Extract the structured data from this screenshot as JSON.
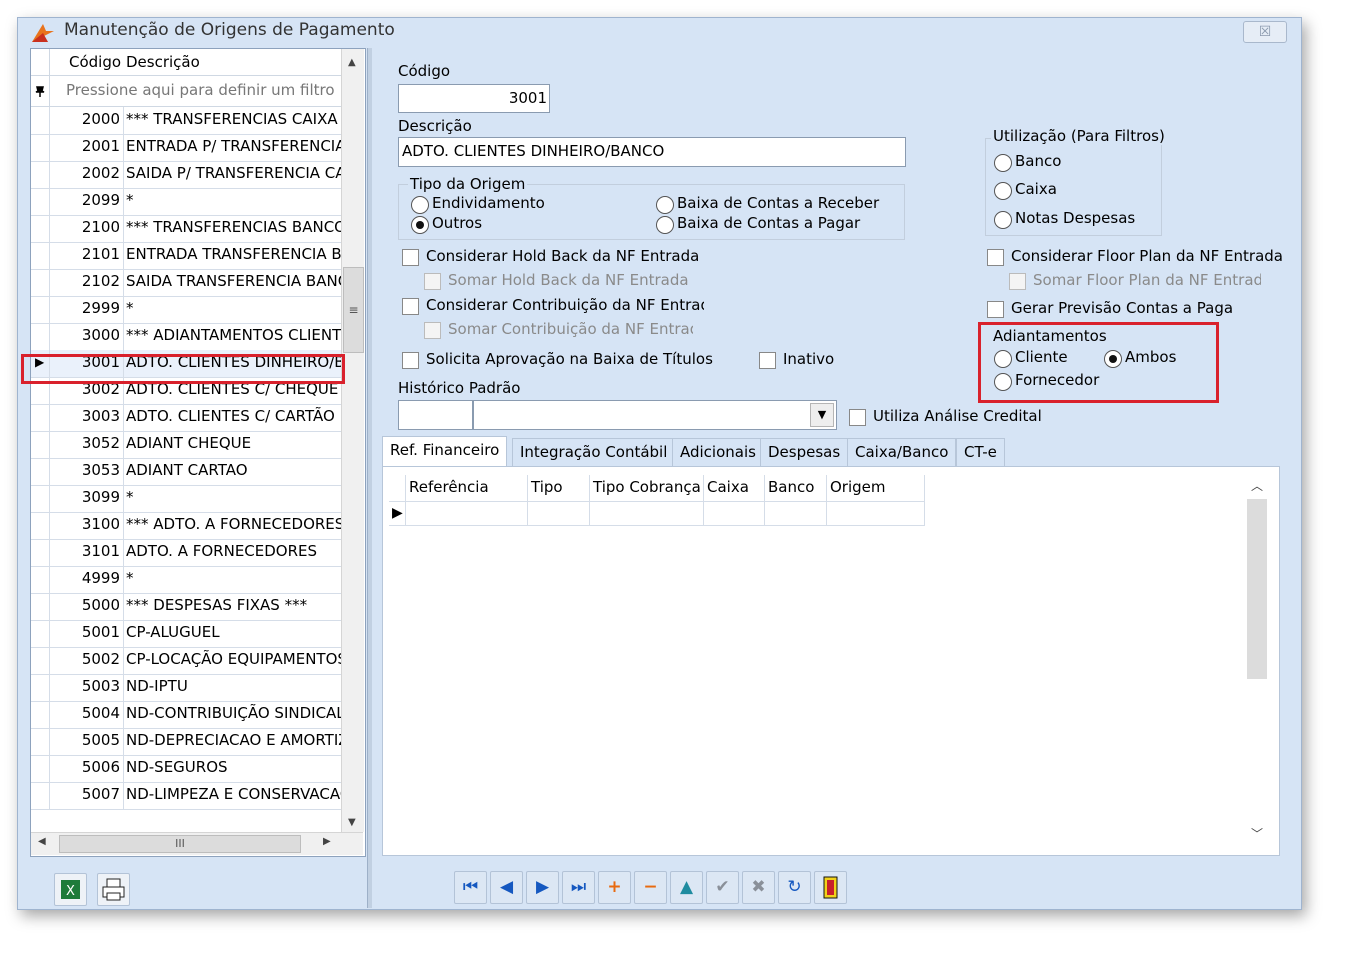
{
  "window": {
    "title": "Manutenção de Origens de Pagamento",
    "close_symbol": "☒"
  },
  "grid": {
    "headers": {
      "code": "Código",
      "desc": "Descrição"
    },
    "filter_placeholder": "Pressione aqui para definir um filtro",
    "rows": [
      {
        "code": "2000",
        "desc": "*** TRANSFERENCIAS CAIXA"
      },
      {
        "code": "2001",
        "desc": "ENTRADA P/ TRANSFERENCIA"
      },
      {
        "code": "2002",
        "desc": "SAIDA P/ TRANSFERENCIA CA"
      },
      {
        "code": "2099",
        "desc": "*"
      },
      {
        "code": "2100",
        "desc": "*** TRANSFERENCIAS BANCO"
      },
      {
        "code": "2101",
        "desc": "ENTRADA TRANSFERENCIA BA"
      },
      {
        "code": "2102",
        "desc": "SAIDA TRANSFERENCIA BANCO"
      },
      {
        "code": "2999",
        "desc": "*"
      },
      {
        "code": "3000",
        "desc": "*** ADIANTAMENTOS CLIENTES"
      },
      {
        "code": "3001",
        "desc": "ADTO. CLIENTES DINHEIRO/B"
      },
      {
        "code": "3002",
        "desc": "ADTO. CLIENTES C/ CHEQUE"
      },
      {
        "code": "3003",
        "desc": "ADTO. CLIENTES C/ CARTÃO"
      },
      {
        "code": "3052",
        "desc": "ADIANT CHEQUE"
      },
      {
        "code": "3053",
        "desc": "ADIANT CARTAO"
      },
      {
        "code": "3099",
        "desc": "*"
      },
      {
        "code": "3100",
        "desc": "*** ADTO. A FORNECEDORES"
      },
      {
        "code": "3101",
        "desc": "ADTO. A FORNECEDORES"
      },
      {
        "code": "4999",
        "desc": "*"
      },
      {
        "code": "5000",
        "desc": "*** DESPESAS FIXAS ***"
      },
      {
        "code": "5001",
        "desc": "CP-ALUGUEL"
      },
      {
        "code": "5002",
        "desc": "CP-LOCAÇÃO EQUIPAMENTOS"
      },
      {
        "code": "5003",
        "desc": "ND-IPTU"
      },
      {
        "code": "5004",
        "desc": "ND-CONTRIBUIÇÃO SINDICAL"
      },
      {
        "code": "5005",
        "desc": "ND-DEPRECIACAO E AMORTIZ"
      },
      {
        "code": "5006",
        "desc": "ND-SEGUROS"
      },
      {
        "code": "5007",
        "desc": "ND-LIMPEZA E CONSERVACAO"
      }
    ],
    "selected_code": "3001"
  },
  "form": {
    "codigo_label": "Código",
    "codigo_value": "3001",
    "descricao_label": "Descrição",
    "descricao_value": "ADTO. CLIENTES DINHEIRO/BANCO",
    "tipo_origem": {
      "label": "Tipo da Origem",
      "opt_endividamento": "Endividamento",
      "opt_outros": "Outros",
      "opt_receber": "Baixa de Contas a Receber",
      "opt_pagar": "Baixa de Contas a Pagar"
    },
    "utilizacao": {
      "label": "Utilização (Para Filtros)",
      "banco": "Banco",
      "caixa": "Caixa",
      "notas": "Notas Despesas"
    },
    "chk_holdback": "Considerar Hold Back da NF Entrada",
    "chk_somar_holdback": "Somar Hold Back da NF Entrada",
    "chk_contribuicao": "Considerar Contribuição da NF Entrada",
    "chk_somar_contribuicao": "Somar Contribuição da NF Entrada",
    "chk_aprovacao": "Solicita Aprovação na Baixa de Títulos",
    "chk_inativo": "Inativo",
    "chk_floorplan": "Considerar Floor Plan da NF Entrada",
    "chk_somar_floorplan": "Somar Floor Plan da NF Entrada",
    "chk_previsao": "Gerar Previsão Contas a Pagar",
    "adiantamentos": {
      "label": "Adiantamentos",
      "cliente": "Cliente",
      "ambos": "Ambos",
      "fornecedor": "Fornecedor"
    },
    "historico_label": "Histórico Padrão",
    "chk_analise": "Utiliza Análise Credital"
  },
  "tabs": [
    "Ref. Financeiro",
    "Integração Contábil",
    "Adicionais",
    "Despesas",
    "Caixa/Banco",
    "CT-e"
  ],
  "subgrid_headers": [
    "Referência",
    "Tipo",
    "Tipo Cobrança",
    "Caixa",
    "Banco",
    "Origem"
  ],
  "nav_icons": [
    "first-icon",
    "prev-icon",
    "next-icon",
    "last-icon",
    "add-icon",
    "delete-icon",
    "edit-icon",
    "confirm-icon",
    "cancel-icon",
    "refresh-icon",
    "exit-icon"
  ],
  "scroll": {
    "h_thumb": "III",
    "v_thumb": "≡"
  }
}
